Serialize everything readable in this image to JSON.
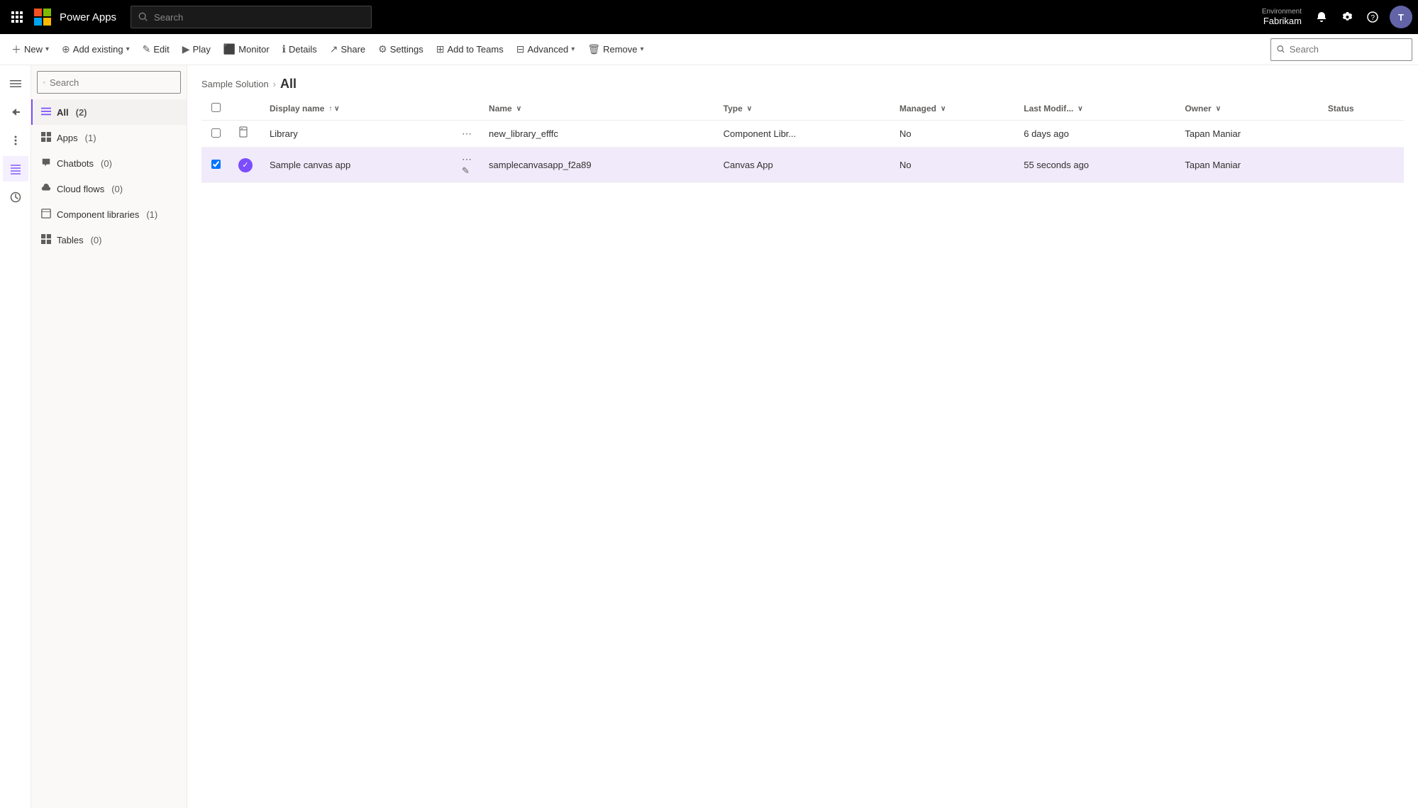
{
  "topnav": {
    "app_name": "Power Apps",
    "search_placeholder": "Search",
    "env_label": "Environment",
    "env_name": "Fabrikam"
  },
  "commandbar": {
    "new_label": "New",
    "add_existing_label": "Add existing",
    "edit_label": "Edit",
    "play_label": "Play",
    "monitor_label": "Monitor",
    "details_label": "Details",
    "share_label": "Share",
    "settings_label": "Settings",
    "add_to_teams_label": "Add to Teams",
    "advanced_label": "Advanced",
    "remove_label": "Remove",
    "search_placeholder": "Search"
  },
  "sidebar": {
    "search_placeholder": "Search",
    "items": [
      {
        "label": "All",
        "count": "(2)",
        "icon": "≡",
        "active": true
      },
      {
        "label": "Apps",
        "count": "(1)",
        "icon": "⊞",
        "active": false
      },
      {
        "label": "Chatbots",
        "count": "(0)",
        "icon": "💬",
        "active": false
      },
      {
        "label": "Cloud flows",
        "count": "(0)",
        "icon": "↻",
        "active": false
      },
      {
        "label": "Component libraries",
        "count": "(1)",
        "icon": "⊟",
        "active": false
      },
      {
        "label": "Tables",
        "count": "(0)",
        "icon": "⊞",
        "active": false
      }
    ]
  },
  "breadcrumb": {
    "parent": "Sample Solution",
    "current": "All"
  },
  "table": {
    "columns": [
      {
        "key": "display_name",
        "label": "Display name",
        "sortable": true,
        "sorted": "asc"
      },
      {
        "key": "name",
        "label": "Name",
        "sortable": true
      },
      {
        "key": "type",
        "label": "Type",
        "sortable": true
      },
      {
        "key": "managed",
        "label": "Managed",
        "sortable": true
      },
      {
        "key": "last_modified",
        "label": "Last Modif...",
        "sortable": true
      },
      {
        "key": "owner",
        "label": "Owner",
        "sortable": true
      },
      {
        "key": "status",
        "label": "Status",
        "sortable": false
      }
    ],
    "rows": [
      {
        "id": 1,
        "display_name": "Library",
        "name": "new_library_efffc",
        "type": "Component Libr...",
        "managed": "No",
        "last_modified": "6 days ago",
        "owner": "Tapan Maniar",
        "status": "",
        "selected": false,
        "icon_type": "library"
      },
      {
        "id": 2,
        "display_name": "Sample canvas app",
        "name": "samplecanvasapp_f2a89",
        "type": "Canvas App",
        "managed": "No",
        "last_modified": "55 seconds ago",
        "owner": "Tapan Maniar",
        "status": "",
        "selected": true,
        "icon_type": "canvas"
      }
    ]
  }
}
